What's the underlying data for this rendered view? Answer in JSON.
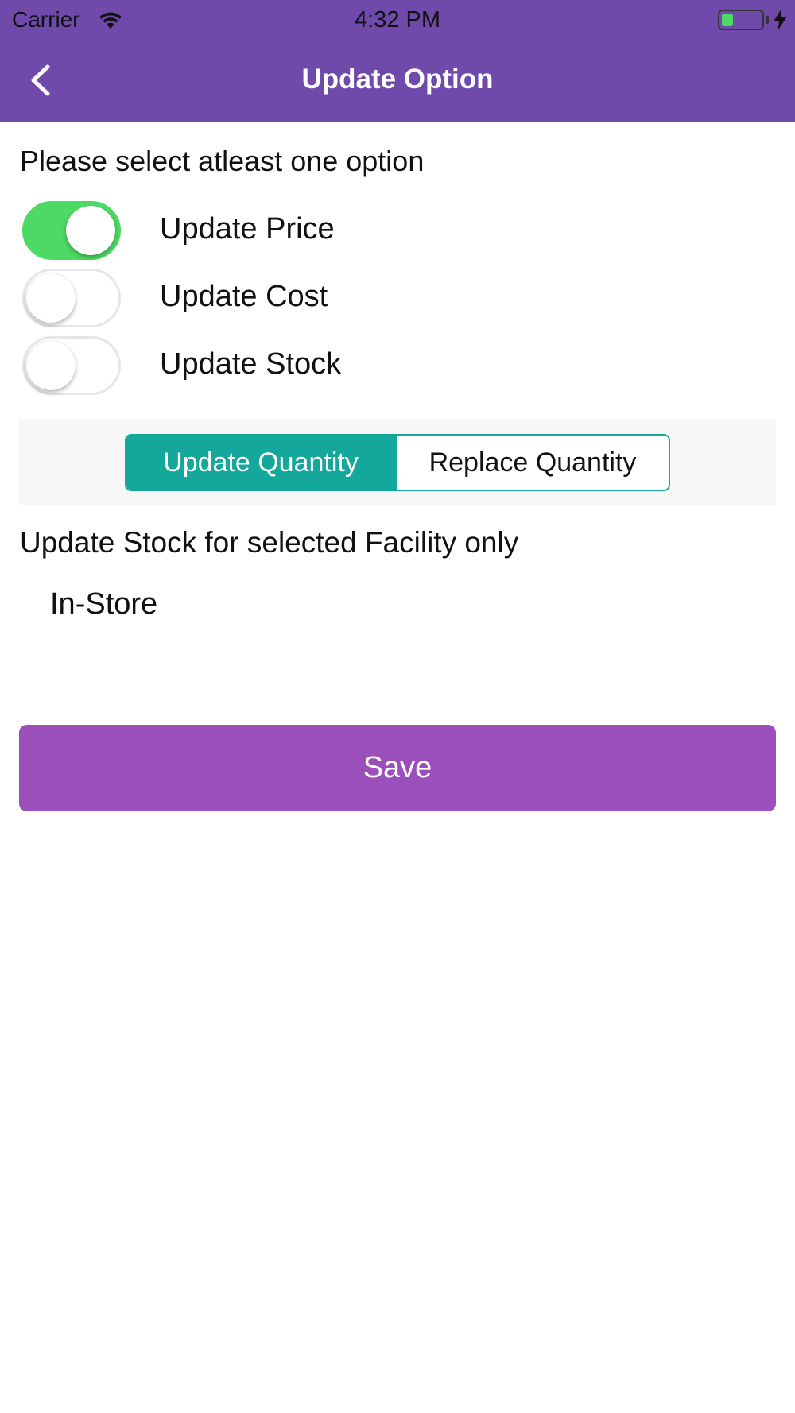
{
  "status_bar": {
    "carrier": "Carrier",
    "time": "4:32 PM",
    "battery_level": 0.3,
    "battery_color": "#4cd964"
  },
  "nav": {
    "title": "Update Option",
    "back_icon": "chevron-left-icon",
    "background_color": "#6f4aab"
  },
  "form": {
    "prompt": "Please select atleast one option",
    "toggles": [
      {
        "label": "Update Price",
        "on": true
      },
      {
        "label": "Update Cost",
        "on": false
      },
      {
        "label": "Update Stock",
        "on": false
      }
    ],
    "segments": [
      {
        "label": "Update Quantity",
        "selected": true
      },
      {
        "label": "Replace Quantity",
        "selected": false
      }
    ],
    "segment_color": "#14a89c",
    "toggle_on_color": "#4cd964",
    "facility_title": "Update Stock for selected Facility only",
    "facilities": [
      "In-Store"
    ],
    "save_label": "Save",
    "save_color": "#9b4fba"
  }
}
